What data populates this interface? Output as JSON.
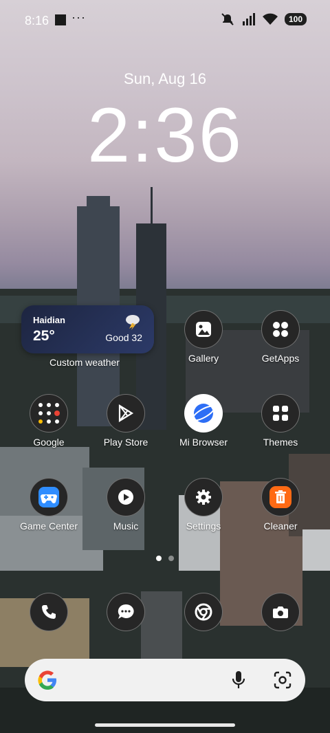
{
  "status_bar": {
    "time": "8:16",
    "dots": "···",
    "battery": "100"
  },
  "lock": {
    "date": "Sun, Aug 16",
    "clock": "2:36"
  },
  "weather_widget": {
    "city": "Haidian",
    "temperature": "25°",
    "condition": "Good 32",
    "label": "Custom weather"
  },
  "apps": {
    "gallery": "Gallery",
    "getapps": "GetApps",
    "google": "Google",
    "playstore": "Play Store",
    "mibrowser": "Mi Browser",
    "themes": "Themes",
    "gamecenter": "Game Center",
    "music": "Music",
    "settings": "Settings",
    "cleaner": "Cleaner"
  },
  "dock": [
    "phone",
    "messages",
    "chrome",
    "camera"
  ],
  "search": {
    "placeholder": ""
  },
  "pager": {
    "pages": 2,
    "active": 1
  }
}
